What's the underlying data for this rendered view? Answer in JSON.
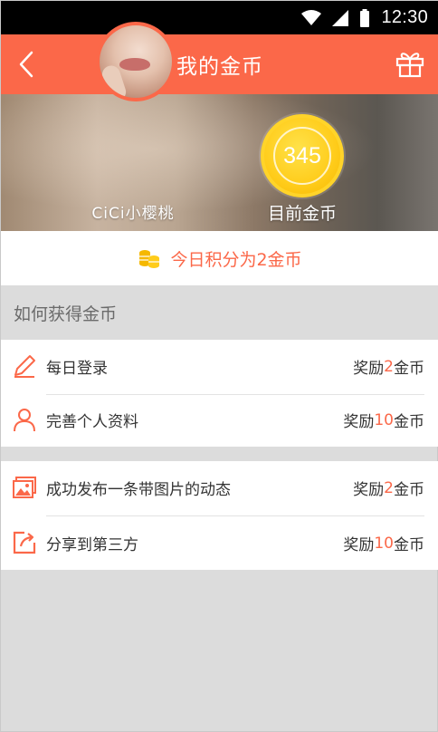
{
  "status_bar": {
    "time": "12:30"
  },
  "header": {
    "title": "我的金币"
  },
  "profile": {
    "username": "CiCi小樱桃"
  },
  "coins": {
    "balance": "345",
    "label": "目前金币"
  },
  "today": {
    "text": "今日积分为2金币"
  },
  "section": {
    "title": "如何获得金币"
  },
  "tasks_group_1": [
    {
      "label": "每日登录",
      "reward_prefix": "奖励",
      "reward_amount": "2",
      "reward_suffix": "金币",
      "icon": "pencil-icon"
    },
    {
      "label": "完善个人资料",
      "reward_prefix": "奖励",
      "reward_amount": "10",
      "reward_suffix": "金币",
      "icon": "person-icon"
    }
  ],
  "tasks_group_2": [
    {
      "label": "成功发布一条带图片的动态",
      "reward_prefix": "奖励",
      "reward_amount": "2",
      "reward_suffix": "金币",
      "icon": "image-icon"
    },
    {
      "label": "分享到第三方",
      "reward_prefix": "奖励",
      "reward_amount": "10",
      "reward_suffix": "金币",
      "icon": "share-icon"
    }
  ],
  "colors": {
    "accent": "#fb6849",
    "coin": "#ffcc1a",
    "background": "#dcdcdc"
  }
}
